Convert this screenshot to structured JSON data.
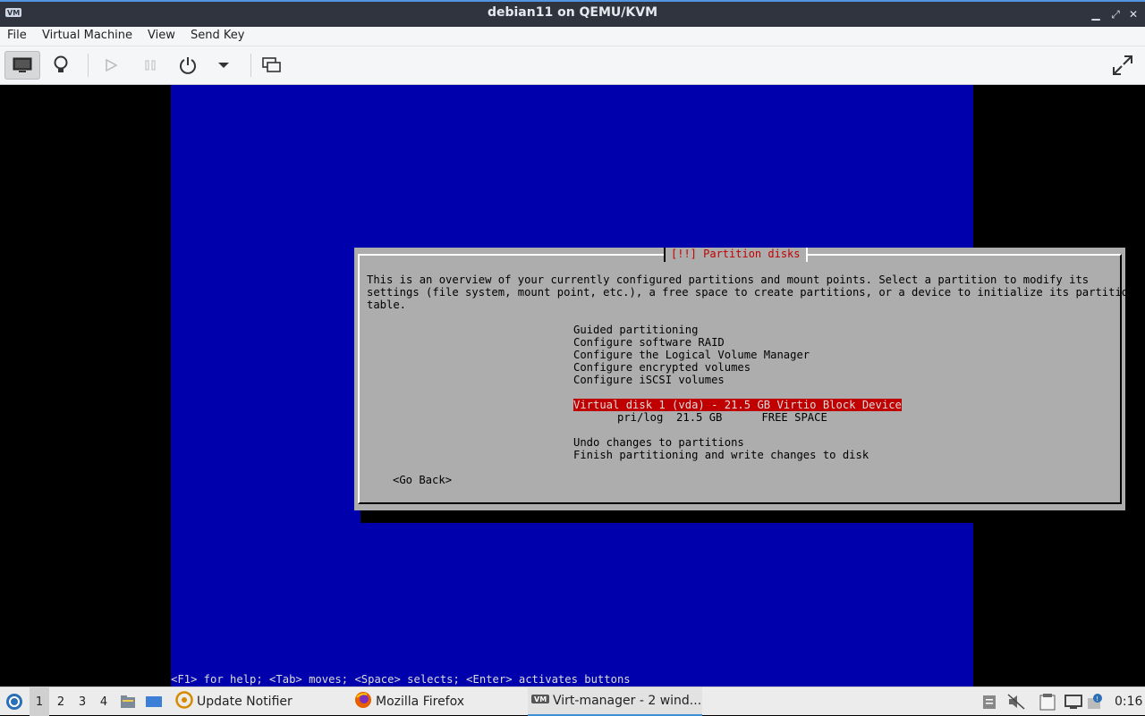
{
  "window": {
    "title": "debian11 on QEMU/KVM",
    "icon": "virt-manager-icon"
  },
  "menu": [
    "File",
    "Virtual Machine",
    "View",
    "Send Key"
  ],
  "toolbar": {
    "buttons": [
      "console-icon",
      "lightbulb-icon",
      "run-icon",
      "pause-icon",
      "power-icon",
      "dropdown-icon",
      "snapshot-icon",
      "fullscreen-icon"
    ]
  },
  "installer": {
    "title": "[!!] Partition disks",
    "description": [
      "This is an overview of your currently configured partitions and mount points. Select a partition to modify its",
      "settings (file system, mount point, etc.), a free space to create partitions, or a device to initialize its partition",
      "table."
    ],
    "menu_items": [
      "Guided partitioning",
      "Configure software RAID",
      "Configure the Logical Volume Manager",
      "Configure encrypted volumes",
      "Configure iSCSI volumes"
    ],
    "disk": "Virtual disk 1 (vda) - 21.5 GB Virtio Block Device",
    "free_space": "pri/log  21.5 GB      FREE SPACE",
    "actions": [
      "Undo changes to partitions",
      "Finish partitioning and write changes to disk"
    ],
    "go_back": "<Go Back>",
    "help": "<F1> for help; <Tab> moves; <Space> selects; <Enter> activates buttons"
  },
  "taskbar": {
    "workspaces": [
      "1",
      "2",
      "3",
      "4"
    ],
    "tasks": [
      "Update Notifier",
      "Mozilla Firefox",
      "Virt-manager - 2 wind..."
    ],
    "clock": "0:16",
    "accent": "#3d8fd6"
  }
}
